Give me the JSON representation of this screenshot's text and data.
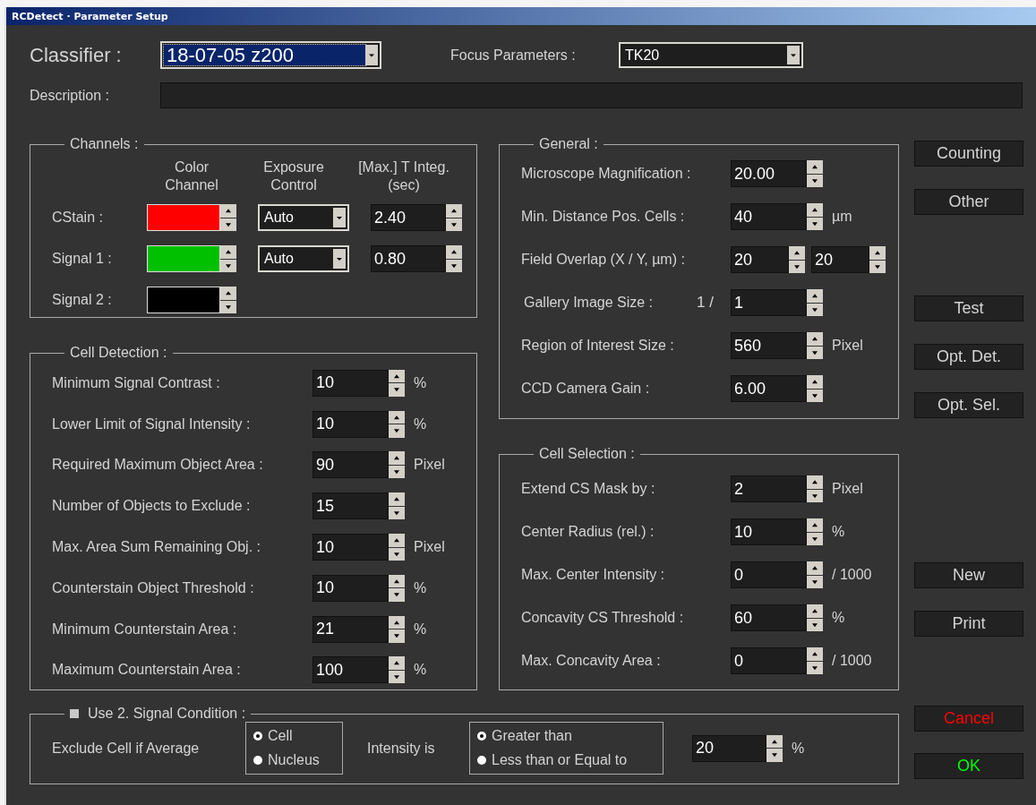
{
  "window": {
    "title": "RCDetect · Parameter Setup"
  },
  "classifier": {
    "label": "Classifier :",
    "value": "18-07-05 z200",
    "focused": true
  },
  "focus_parameters": {
    "label": "Focus Parameters :",
    "value": "TK20",
    "focused": false
  },
  "description": {
    "label": "Description :"
  },
  "channels": {
    "title": "Channels :",
    "columns": [
      "Color\nChannel",
      "Exposure\nControl",
      "[Max.] T Integ.\n(sec)"
    ],
    "rows": [
      {
        "name": "CStain :",
        "color": "#ff0000",
        "exposure": "Auto",
        "t_integ": "2.40"
      },
      {
        "name": "Signal 1 :",
        "color": "#00c000",
        "exposure": "Auto",
        "t_integ": "0.80"
      },
      {
        "name": "Signal 2 :",
        "color": "#000000"
      }
    ]
  },
  "cell_detection": {
    "title": "Cell Detection :",
    "rows": [
      {
        "label": "Minimum Signal Contrast :",
        "value": "10",
        "unit": "%"
      },
      {
        "label": "Lower Limit of Signal Intensity :",
        "value": "10",
        "unit": "%"
      },
      {
        "label": "Required Maximum Object Area :",
        "value": "90",
        "unit": "Pixel"
      },
      {
        "label": "Number of Objects to Exclude :",
        "value": "15"
      },
      {
        "label": "Max. Area Sum Remaining Obj. :",
        "value": "10",
        "unit": "Pixel"
      },
      {
        "label": "Counterstain Object Threshold :",
        "value": "10",
        "unit": "%"
      },
      {
        "label": "Minimum Counterstain Area :",
        "value": "21",
        "unit": "%"
      },
      {
        "label": "Maximum Counterstain Area :",
        "value": "100",
        "unit": "%"
      }
    ]
  },
  "general": {
    "title": "General :",
    "rows": [
      {
        "kind": "spin",
        "label": "Microscope Magnification :",
        "value": "20.00"
      },
      {
        "kind": "spin",
        "label": "Min. Distance Pos. Cells :",
        "value": "40",
        "unit": "µm"
      },
      {
        "kind": "pair",
        "label": "Field Overlap (X / Y, µm) :",
        "values": [
          "20",
          "20"
        ]
      },
      {
        "kind": "fraction",
        "label": "Gallery Image Size :",
        "prefix": "1 /",
        "value": "1"
      },
      {
        "kind": "spin",
        "label": "Region of Interest Size :",
        "value": "560",
        "unit": "Pixel"
      },
      {
        "kind": "spin",
        "label": "CCD Camera Gain :",
        "value": "6.00"
      }
    ]
  },
  "cell_selection": {
    "title": "Cell Selection :",
    "rows": [
      {
        "label": "Extend CS Mask by :",
        "value": "2",
        "unit": "Pixel"
      },
      {
        "label": "Center Radius (rel.) :",
        "value": "10",
        "unit": "%"
      },
      {
        "label": "Max. Center Intensity :",
        "value": "0",
        "unit": "/ 1000"
      },
      {
        "label": "Concavity CS Threshold :",
        "value": "60",
        "unit": "%"
      },
      {
        "label": "Max. Concavity Area :",
        "value": "0",
        "unit": "/ 1000"
      }
    ]
  },
  "side_buttons": [
    [
      {
        "label": "Counting"
      },
      {
        "label": "Other"
      }
    ],
    [
      {
        "label": "Test"
      },
      {
        "label": "Opt. Det."
      },
      {
        "label": "Opt. Sel."
      }
    ],
    [
      {
        "label": "New"
      },
      {
        "label": "Print"
      }
    ]
  ],
  "signal_condition": {
    "label": "Use 2. Signal Condition :",
    "checked": false,
    "exclude_label": "Exclude Cell if Average",
    "cell_options": [
      {
        "label": "Cell",
        "selected": true
      },
      {
        "label": "Nucleus",
        "selected": false
      }
    ],
    "intensity_label": "Intensity is",
    "intensity_options": [
      {
        "label": "Greater than",
        "selected": true
      },
      {
        "label": "Less than or Equal to",
        "selected": false
      }
    ],
    "value": "20",
    "unit": "%"
  },
  "footer_buttons": [
    {
      "label": "Cancel",
      "color": "#ff0000"
    },
    {
      "label": "OK",
      "color": "#00ff00"
    }
  ]
}
